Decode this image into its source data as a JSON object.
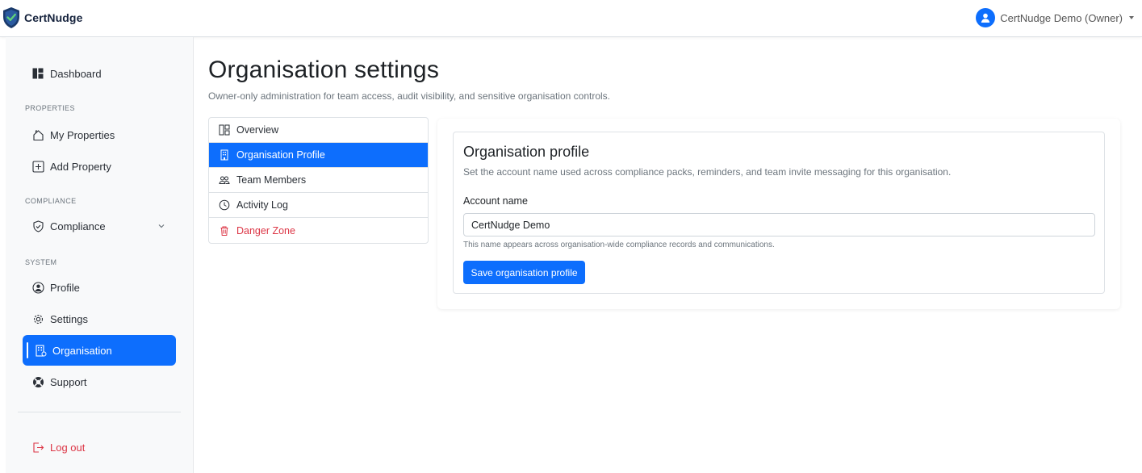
{
  "brand": {
    "name": "CertNudge",
    "logo_icon": "shield-check-icon"
  },
  "user_menu": {
    "label": "CertNudge Demo (Owner)",
    "avatar_icon": "person-circle-icon"
  },
  "sidebar": {
    "dashboard": "Dashboard",
    "sections": {
      "properties": "PROPERTIES",
      "compliance": "COMPLIANCE",
      "system": "SYSTEM"
    },
    "my_properties": "My Properties",
    "add_property": "Add Property",
    "compliance": "Compliance",
    "profile": "Profile",
    "settings": "Settings",
    "organisation": "Organisation",
    "support": "Support",
    "logout": "Log out"
  },
  "page": {
    "title": "Organisation settings",
    "subtitle": "Owner-only administration for team access, audit visibility, and sensitive organisation controls."
  },
  "tabs": {
    "overview": "Overview",
    "organisation_profile": "Organisation Profile",
    "team_members": "Team Members",
    "activity_log": "Activity Log",
    "danger_zone": "Danger Zone"
  },
  "profile_card": {
    "title": "Organisation profile",
    "description": "Set the account name used across compliance packs, reminders, and team invite messaging for this organisation.",
    "account_label": "Account name",
    "account_value": "CertNudge Demo",
    "help": "This name appears across organisation-wide compliance records and communications.",
    "save_label": "Save organisation profile"
  },
  "colors": {
    "primary": "#0d6efd",
    "danger": "#dc3545",
    "muted": "#6c757d",
    "sidebar_bg": "#f8f9fa"
  }
}
